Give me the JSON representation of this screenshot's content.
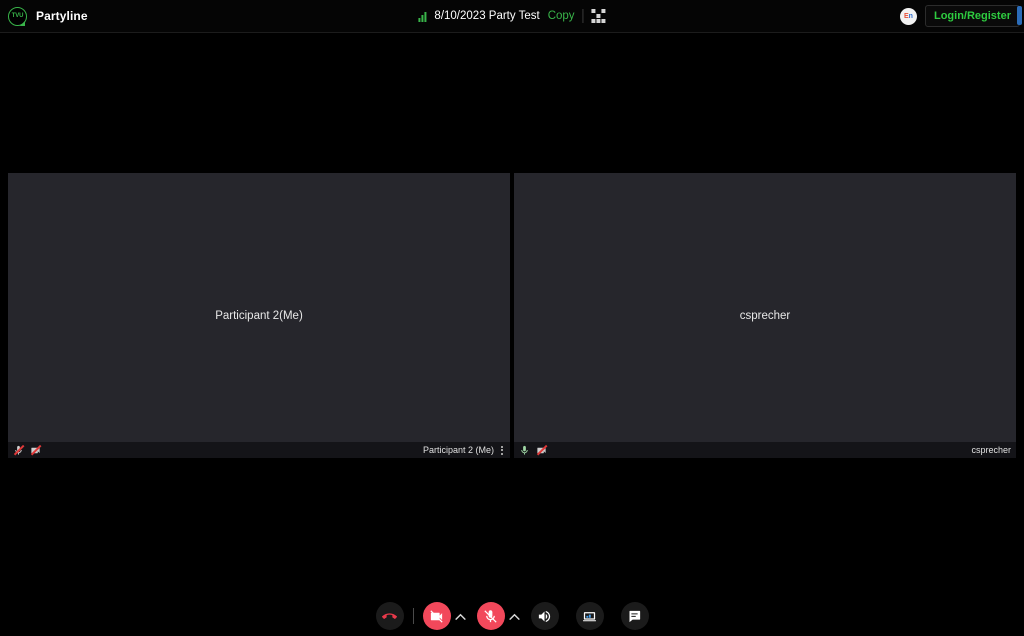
{
  "header": {
    "logo_text": "TVU",
    "logo_icon": "tvu-logo-icon",
    "brand_name": "Partyline",
    "signal_icon": "signal-bars-icon",
    "session_title": "8/10/2023 Party Test",
    "copy_label": "Copy",
    "qr_icon": "qr-code-icon",
    "language_label": "En",
    "language_icon": "language-globe-icon",
    "login_label": "Login/Register"
  },
  "tiles": [
    {
      "center_name": "Participant 2(Me)",
      "footer_name": "Participant 2 (Me)",
      "mic_icon": "microphone-muted-icon",
      "mic_muted": true,
      "camera_icon": "camera-off-icon",
      "camera_off": true,
      "menu_icon": "kebab-menu-icon",
      "has_menu": true
    },
    {
      "center_name": "csprecher",
      "footer_name": "csprecher",
      "mic_icon": "microphone-on-icon",
      "mic_muted": false,
      "camera_icon": "camera-off-icon",
      "camera_off": true,
      "menu_icon": "",
      "has_menu": false
    }
  ],
  "controls": [
    {
      "name": "hangup-button",
      "icon": "phone-hangup-icon",
      "label": "Hang Up",
      "state": "idle"
    },
    {
      "name": "camera-toggle-button",
      "icon": "camera-off-icon",
      "label": "Camera Off",
      "state": "active-off"
    },
    {
      "name": "camera-options-button",
      "icon": "chevron-up-icon",
      "label": "Camera Options",
      "state": "idle"
    },
    {
      "name": "microphone-toggle-button",
      "icon": "microphone-muted-icon",
      "label": "Microphone Muted",
      "state": "active-off"
    },
    {
      "name": "microphone-options-button",
      "icon": "chevron-up-icon",
      "label": "Microphone Options",
      "state": "idle"
    },
    {
      "name": "speaker-button",
      "icon": "speaker-icon",
      "label": "Speaker",
      "state": "idle"
    },
    {
      "name": "screen-share-button",
      "icon": "screen-share-icon",
      "label": "Share Screen",
      "state": "idle"
    },
    {
      "name": "chat-button",
      "icon": "chat-bubble-icon",
      "label": "Chat",
      "state": "idle"
    }
  ],
  "colors": {
    "accent_green": "#39b54a",
    "danger_red": "#f2485b",
    "muted_red": "#e03a3a",
    "background": "#000000",
    "tile_background": "#26262c"
  }
}
